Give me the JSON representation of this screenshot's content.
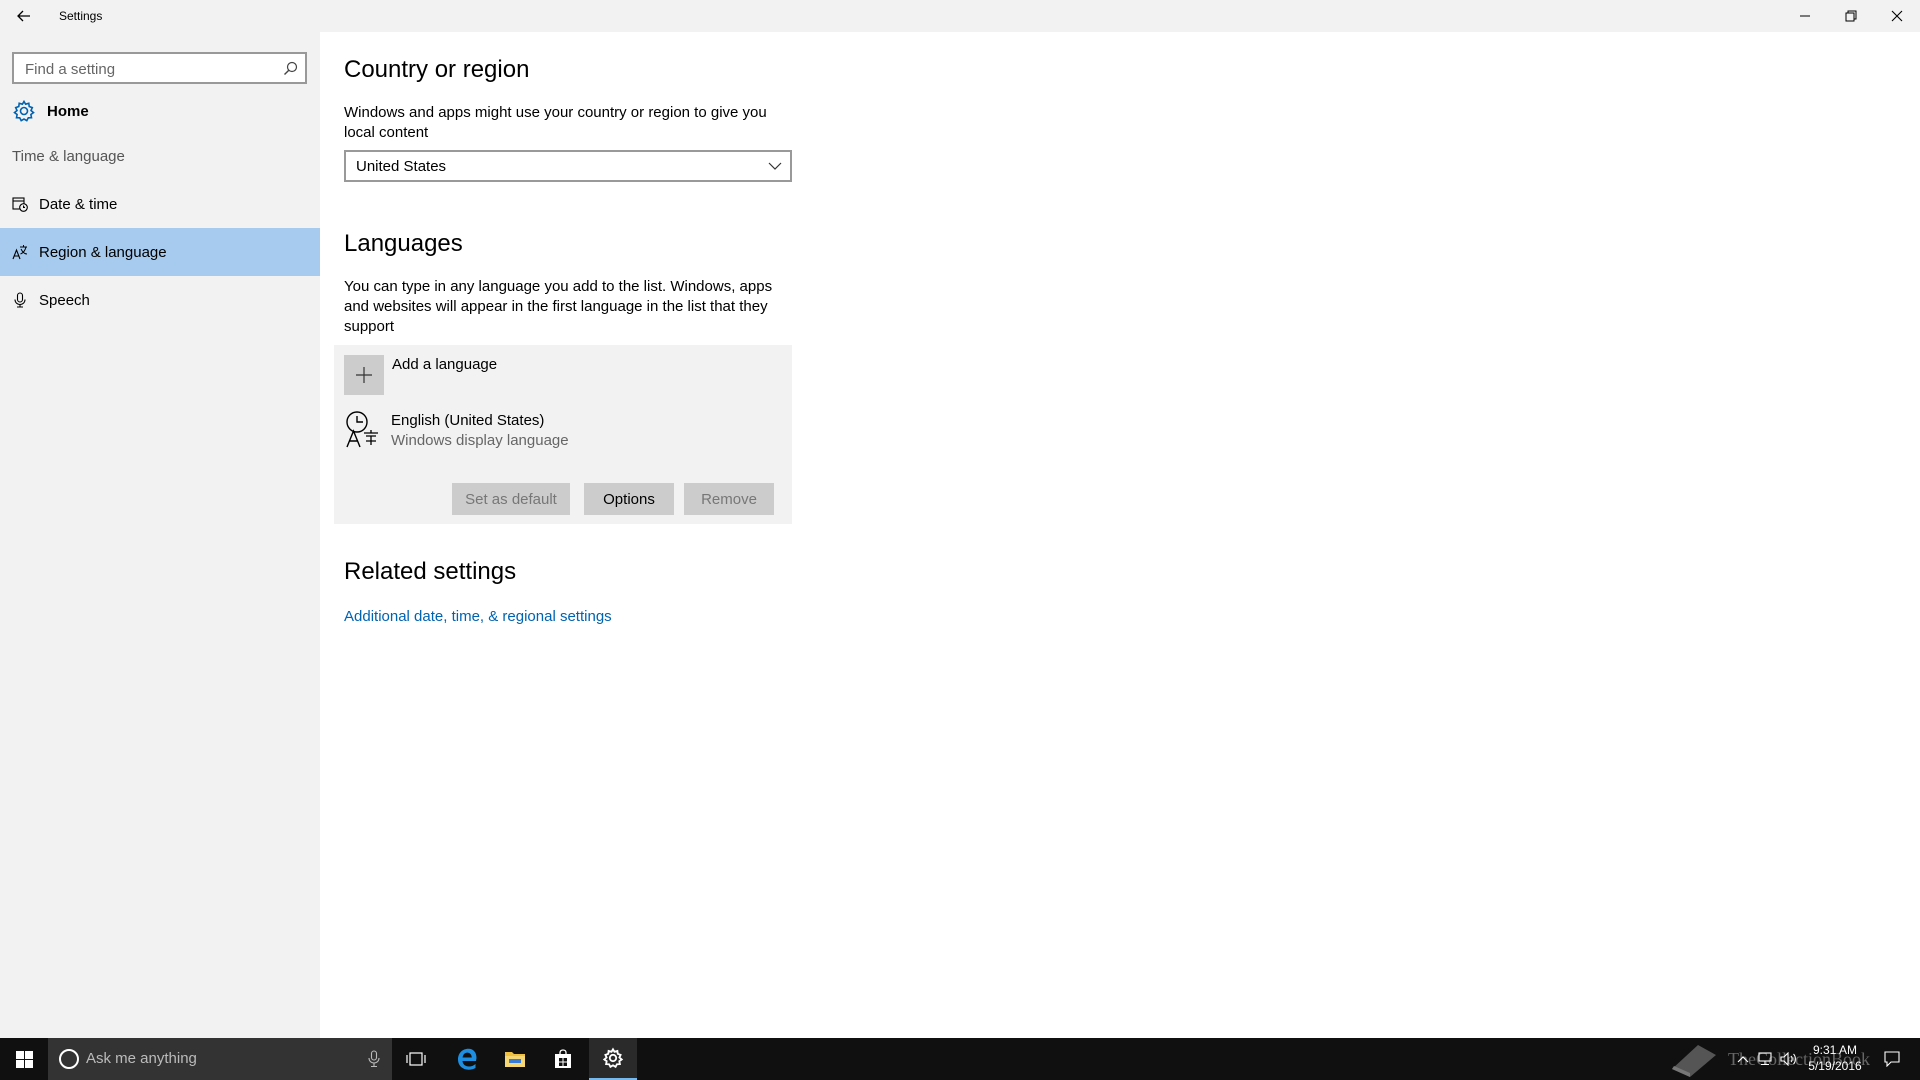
{
  "window": {
    "title": "Settings"
  },
  "sidebar": {
    "search_placeholder": "Find a setting",
    "home_label": "Home",
    "group_label": "Time & language",
    "items": [
      {
        "label": "Date & time",
        "icon": "calendar-clock-icon"
      },
      {
        "label": "Region & language",
        "icon": "region-language-icon",
        "selected": true
      },
      {
        "label": "Speech",
        "icon": "microphone-icon"
      }
    ]
  },
  "main": {
    "country": {
      "title": "Country or region",
      "description": "Windows and apps might use your country or region to give you local content",
      "selected": "United States"
    },
    "languages": {
      "title": "Languages",
      "description": "You can type in any language you add to the list. Windows, apps and websites will appear in the first language in the list that they support",
      "add_label": "Add a language",
      "items": [
        {
          "name": "English (United States)",
          "subtitle": "Windows display language"
        }
      ],
      "buttons": {
        "set_default": "Set as default",
        "options": "Options",
        "remove": "Remove"
      }
    },
    "related": {
      "title": "Related settings",
      "link": "Additional date, time, & regional settings"
    }
  },
  "taskbar": {
    "search_placeholder": "Ask me anything",
    "time": "9:31 AM",
    "date": "5/19/2016",
    "watermark": "TheCollectionBook",
    "accent": "#76b9ed"
  },
  "colors": {
    "selection": "#a6cbef",
    "link": "#0063b1",
    "sidebar_bg": "#f2f2f2"
  }
}
